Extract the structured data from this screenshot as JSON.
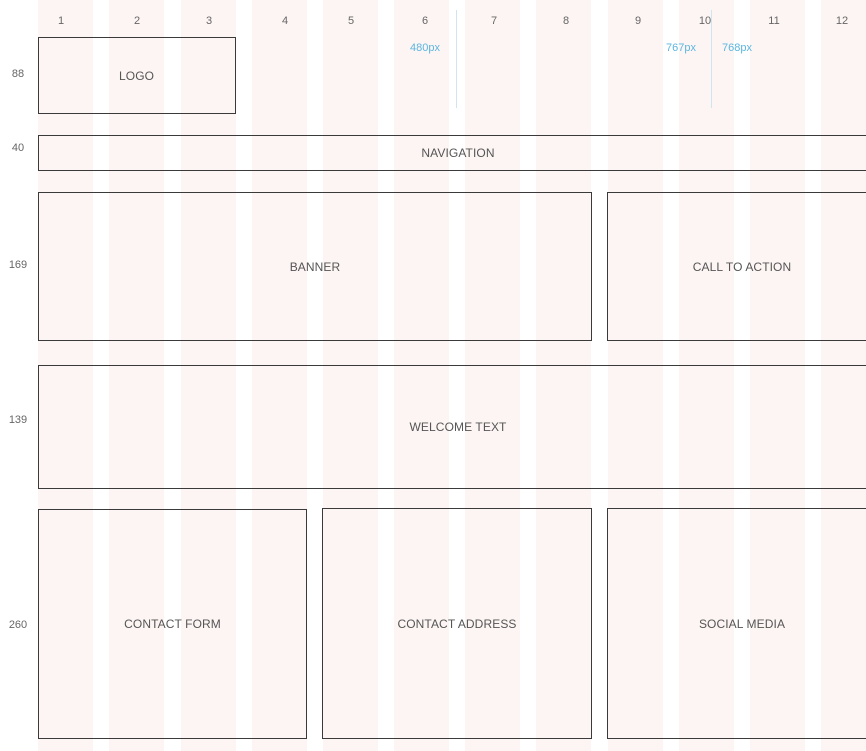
{
  "grid": {
    "columns": [
      "1",
      "2",
      "3",
      "4",
      "5",
      "6",
      "7",
      "8",
      "9",
      "10",
      "11",
      "12"
    ],
    "row_heights": [
      "88",
      "40",
      "169",
      "139",
      "260"
    ]
  },
  "breakpoints": [
    {
      "label": "480px"
    },
    {
      "label": "767px"
    },
    {
      "label": "768px"
    }
  ],
  "blocks": {
    "logo": "LOGO",
    "navigation": "NAVIGATION",
    "banner": "BANNER",
    "call_to_action": "CALL TO ACTION",
    "welcome_text": "WELCOME TEXT",
    "contact_form": "CONTACT FORM",
    "contact_address": "CONTACT ADDRESS",
    "social_media": "SOCIAL MEDIA"
  },
  "colors": {
    "column_stripe": "#fdf5f3",
    "border": "#3a3a3a",
    "breakpoint": "#5bb6e0"
  }
}
